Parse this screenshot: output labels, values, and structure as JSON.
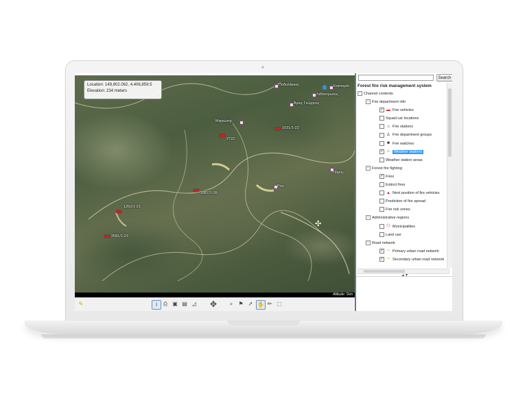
{
  "map": {
    "location_text": "Location: 149,802.062, 4,406,859.5",
    "elevation_text": "Elevation: 234 meters",
    "altitude_text": "Altitude: 1km",
    "labels": {
      "podolakkos": "Ποδολάκκος",
      "kastoriti": "Καστορίτι",
      "lithostrotos": "Λιθόστρωτος",
      "agios_georgios": "Άγιος Γεώργιος",
      "mingiotis": "Μιγγιώτης",
      "v1631": "1631/1-22",
      "v2722": "2722",
      "poros": "Πόρος",
      "rou": "Ρου",
      "v1887": "1887/1-26",
      "v1262": "1262/1-21",
      "v2581": "2581/1-23"
    }
  },
  "panel": {
    "search_button": "Search",
    "tree_title": "Forest fire risk management system",
    "items": [
      {
        "label": "Channel contents"
      },
      {
        "label": "Fire department info"
      },
      {
        "label": "Fire vehicles"
      },
      {
        "label": "Squad car locations"
      },
      {
        "label": "Fire stations"
      },
      {
        "label": "Fire department groups"
      },
      {
        "label": "Fire watches"
      },
      {
        "label": "Weather stations"
      },
      {
        "label": "Weather station areas"
      },
      {
        "label": "Forest fire fighting"
      },
      {
        "label": "Fires"
      },
      {
        "label": "Extinct fires"
      },
      {
        "label": "Next position of fire vehicles"
      },
      {
        "label": "Prediction of fire spread"
      },
      {
        "label": "Fire risk zones"
      },
      {
        "label": "Administrative regions"
      },
      {
        "label": "Municipalities"
      },
      {
        "label": "Land use"
      },
      {
        "label": "Road network"
      },
      {
        "label": "Primary urban road network"
      },
      {
        "label": "Secondary urban road network"
      }
    ]
  },
  "colors": {
    "selection": "#3399ff",
    "vehicle_marker": "#c8202a",
    "road_yellow": "#f2d21b"
  },
  "icons": {
    "toolbar": [
      "wand-icon",
      "info-icon",
      "print-icon",
      "export-icon",
      "document-icon",
      "ruler-icon",
      "navigation-compass-icon",
      "zoom-icon",
      "flag-icon",
      "pointer-icon",
      "hand-icon",
      "pencil-icon",
      "select-area-icon"
    ]
  }
}
